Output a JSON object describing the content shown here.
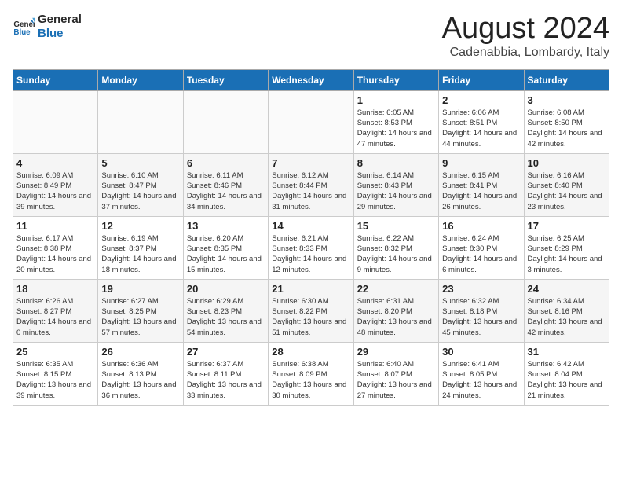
{
  "logo": {
    "line1": "General",
    "line2": "Blue"
  },
  "title": "August 2024",
  "location": "Cadenabbia, Lombardy, Italy",
  "days_of_week": [
    "Sunday",
    "Monday",
    "Tuesday",
    "Wednesday",
    "Thursday",
    "Friday",
    "Saturday"
  ],
  "weeks": [
    [
      {
        "day": "",
        "info": ""
      },
      {
        "day": "",
        "info": ""
      },
      {
        "day": "",
        "info": ""
      },
      {
        "day": "",
        "info": ""
      },
      {
        "day": "1",
        "info": "Sunrise: 6:05 AM\nSunset: 8:53 PM\nDaylight: 14 hours and 47 minutes."
      },
      {
        "day": "2",
        "info": "Sunrise: 6:06 AM\nSunset: 8:51 PM\nDaylight: 14 hours and 44 minutes."
      },
      {
        "day": "3",
        "info": "Sunrise: 6:08 AM\nSunset: 8:50 PM\nDaylight: 14 hours and 42 minutes."
      }
    ],
    [
      {
        "day": "4",
        "info": "Sunrise: 6:09 AM\nSunset: 8:49 PM\nDaylight: 14 hours and 39 minutes."
      },
      {
        "day": "5",
        "info": "Sunrise: 6:10 AM\nSunset: 8:47 PM\nDaylight: 14 hours and 37 minutes."
      },
      {
        "day": "6",
        "info": "Sunrise: 6:11 AM\nSunset: 8:46 PM\nDaylight: 14 hours and 34 minutes."
      },
      {
        "day": "7",
        "info": "Sunrise: 6:12 AM\nSunset: 8:44 PM\nDaylight: 14 hours and 31 minutes."
      },
      {
        "day": "8",
        "info": "Sunrise: 6:14 AM\nSunset: 8:43 PM\nDaylight: 14 hours and 29 minutes."
      },
      {
        "day": "9",
        "info": "Sunrise: 6:15 AM\nSunset: 8:41 PM\nDaylight: 14 hours and 26 minutes."
      },
      {
        "day": "10",
        "info": "Sunrise: 6:16 AM\nSunset: 8:40 PM\nDaylight: 14 hours and 23 minutes."
      }
    ],
    [
      {
        "day": "11",
        "info": "Sunrise: 6:17 AM\nSunset: 8:38 PM\nDaylight: 14 hours and 20 minutes."
      },
      {
        "day": "12",
        "info": "Sunrise: 6:19 AM\nSunset: 8:37 PM\nDaylight: 14 hours and 18 minutes."
      },
      {
        "day": "13",
        "info": "Sunrise: 6:20 AM\nSunset: 8:35 PM\nDaylight: 14 hours and 15 minutes."
      },
      {
        "day": "14",
        "info": "Sunrise: 6:21 AM\nSunset: 8:33 PM\nDaylight: 14 hours and 12 minutes."
      },
      {
        "day": "15",
        "info": "Sunrise: 6:22 AM\nSunset: 8:32 PM\nDaylight: 14 hours and 9 minutes."
      },
      {
        "day": "16",
        "info": "Sunrise: 6:24 AM\nSunset: 8:30 PM\nDaylight: 14 hours and 6 minutes."
      },
      {
        "day": "17",
        "info": "Sunrise: 6:25 AM\nSunset: 8:29 PM\nDaylight: 14 hours and 3 minutes."
      }
    ],
    [
      {
        "day": "18",
        "info": "Sunrise: 6:26 AM\nSunset: 8:27 PM\nDaylight: 14 hours and 0 minutes."
      },
      {
        "day": "19",
        "info": "Sunrise: 6:27 AM\nSunset: 8:25 PM\nDaylight: 13 hours and 57 minutes."
      },
      {
        "day": "20",
        "info": "Sunrise: 6:29 AM\nSunset: 8:23 PM\nDaylight: 13 hours and 54 minutes."
      },
      {
        "day": "21",
        "info": "Sunrise: 6:30 AM\nSunset: 8:22 PM\nDaylight: 13 hours and 51 minutes."
      },
      {
        "day": "22",
        "info": "Sunrise: 6:31 AM\nSunset: 8:20 PM\nDaylight: 13 hours and 48 minutes."
      },
      {
        "day": "23",
        "info": "Sunrise: 6:32 AM\nSunset: 8:18 PM\nDaylight: 13 hours and 45 minutes."
      },
      {
        "day": "24",
        "info": "Sunrise: 6:34 AM\nSunset: 8:16 PM\nDaylight: 13 hours and 42 minutes."
      }
    ],
    [
      {
        "day": "25",
        "info": "Sunrise: 6:35 AM\nSunset: 8:15 PM\nDaylight: 13 hours and 39 minutes."
      },
      {
        "day": "26",
        "info": "Sunrise: 6:36 AM\nSunset: 8:13 PM\nDaylight: 13 hours and 36 minutes."
      },
      {
        "day": "27",
        "info": "Sunrise: 6:37 AM\nSunset: 8:11 PM\nDaylight: 13 hours and 33 minutes."
      },
      {
        "day": "28",
        "info": "Sunrise: 6:38 AM\nSunset: 8:09 PM\nDaylight: 13 hours and 30 minutes."
      },
      {
        "day": "29",
        "info": "Sunrise: 6:40 AM\nSunset: 8:07 PM\nDaylight: 13 hours and 27 minutes."
      },
      {
        "day": "30",
        "info": "Sunrise: 6:41 AM\nSunset: 8:05 PM\nDaylight: 13 hours and 24 minutes."
      },
      {
        "day": "31",
        "info": "Sunrise: 6:42 AM\nSunset: 8:04 PM\nDaylight: 13 hours and 21 minutes."
      }
    ]
  ]
}
